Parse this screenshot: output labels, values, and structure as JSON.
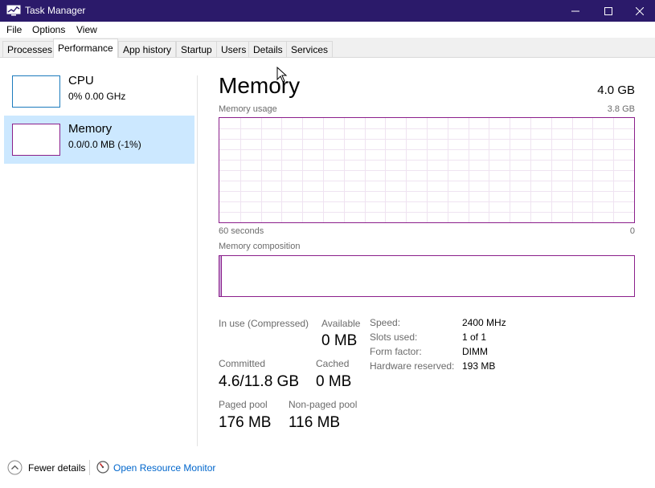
{
  "window": {
    "title": "Task Manager",
    "app_icon": "task-manager-icon",
    "controls": [
      "minimize-icon",
      "maximize-icon",
      "close-icon"
    ],
    "titlebar_color": "#2b1a6a"
  },
  "menu": [
    "File",
    "Options",
    "View"
  ],
  "tabs": [
    {
      "label": "Processes",
      "active": false
    },
    {
      "label": "Performance",
      "active": true
    },
    {
      "label": "App history",
      "active": false
    },
    {
      "label": "Startup",
      "active": false
    },
    {
      "label": "Users",
      "active": false
    },
    {
      "label": "Details",
      "active": false
    },
    {
      "label": "Services",
      "active": false
    }
  ],
  "sidebar": {
    "items": [
      {
        "name": "CPU",
        "detail": "0%  0.00 GHz",
        "selected": false,
        "color": "#1c7bbd"
      },
      {
        "name": "Memory",
        "detail": "0.0/0.0 MB (-1%)",
        "selected": true,
        "color": "#8b1f8b"
      }
    ],
    "selected_bg": "#cce8ff"
  },
  "memory": {
    "heading": "Memory",
    "total": "4.0 GB",
    "usage_label": "Memory usage",
    "usage_max": "3.8 GB",
    "time_span": "60 seconds",
    "time_end": "0",
    "composition_label": "Memory composition",
    "graph_color": "#8b1f8b",
    "stats": {
      "in_use_label": "In use (Compressed)",
      "in_use_value": "",
      "available_label": "Available",
      "available_value": "0 MB",
      "committed_label": "Committed",
      "committed_value": "4.6/11.8 GB",
      "cached_label": "Cached",
      "cached_value": "0 MB",
      "paged_label": "Paged pool",
      "paged_value": "176 MB",
      "nonpaged_label": "Non-paged pool",
      "nonpaged_value": "116 MB"
    },
    "specs": {
      "speed_label": "Speed:",
      "speed_value": "2400 MHz",
      "slots_label": "Slots used:",
      "slots_value": "1 of 1",
      "form_label": "Form factor:",
      "form_value": "DIMM",
      "reserved_label": "Hardware reserved:",
      "reserved_value": "193 MB"
    }
  },
  "footer": {
    "fewer_details": "Fewer details",
    "fewer_icon": "chevron-up-circle-icon",
    "resource_monitor": "Open Resource Monitor",
    "resource_icon": "resource-monitor-icon",
    "link_color": "#0066cc"
  }
}
